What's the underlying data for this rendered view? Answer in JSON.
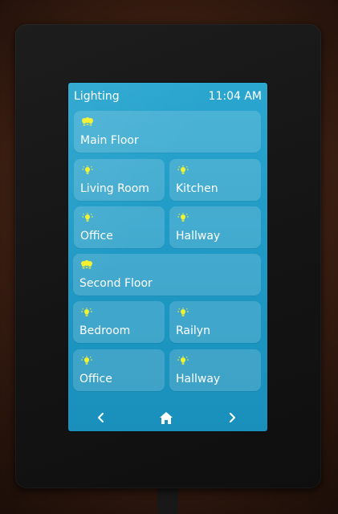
{
  "header": {
    "title": "Lighting",
    "time": "11:04 AM"
  },
  "tiles": [
    {
      "label": "Main Floor",
      "icon": "multi-bulb-icon",
      "on": true
    },
    {
      "label": "Living Room",
      "icon": "bulb-icon",
      "on": true
    },
    {
      "label": "Kitchen",
      "icon": "bulb-icon",
      "on": true
    },
    {
      "label": "Office",
      "icon": "bulb-icon",
      "on": true
    },
    {
      "label": "Hallway",
      "icon": "bulb-icon",
      "on": true
    },
    {
      "label": "Second Floor",
      "icon": "multi-bulb-icon",
      "on": true
    },
    {
      "label": "Bedroom",
      "icon": "bulb-icon",
      "on": true
    },
    {
      "label": "Railyn",
      "icon": "bulb-icon",
      "on": true
    },
    {
      "label": "Office",
      "icon": "bulb-icon",
      "on": true
    },
    {
      "label": "Hallway",
      "icon": "bulb-icon",
      "on": true
    }
  ],
  "nav": {
    "back_icon": "chevron-left-icon",
    "home_icon": "home-icon",
    "forward_icon": "chevron-right-icon"
  },
  "colors": {
    "screen": "#1e98c4",
    "bulb_on": "#f2f230",
    "text": "#ffffff"
  }
}
